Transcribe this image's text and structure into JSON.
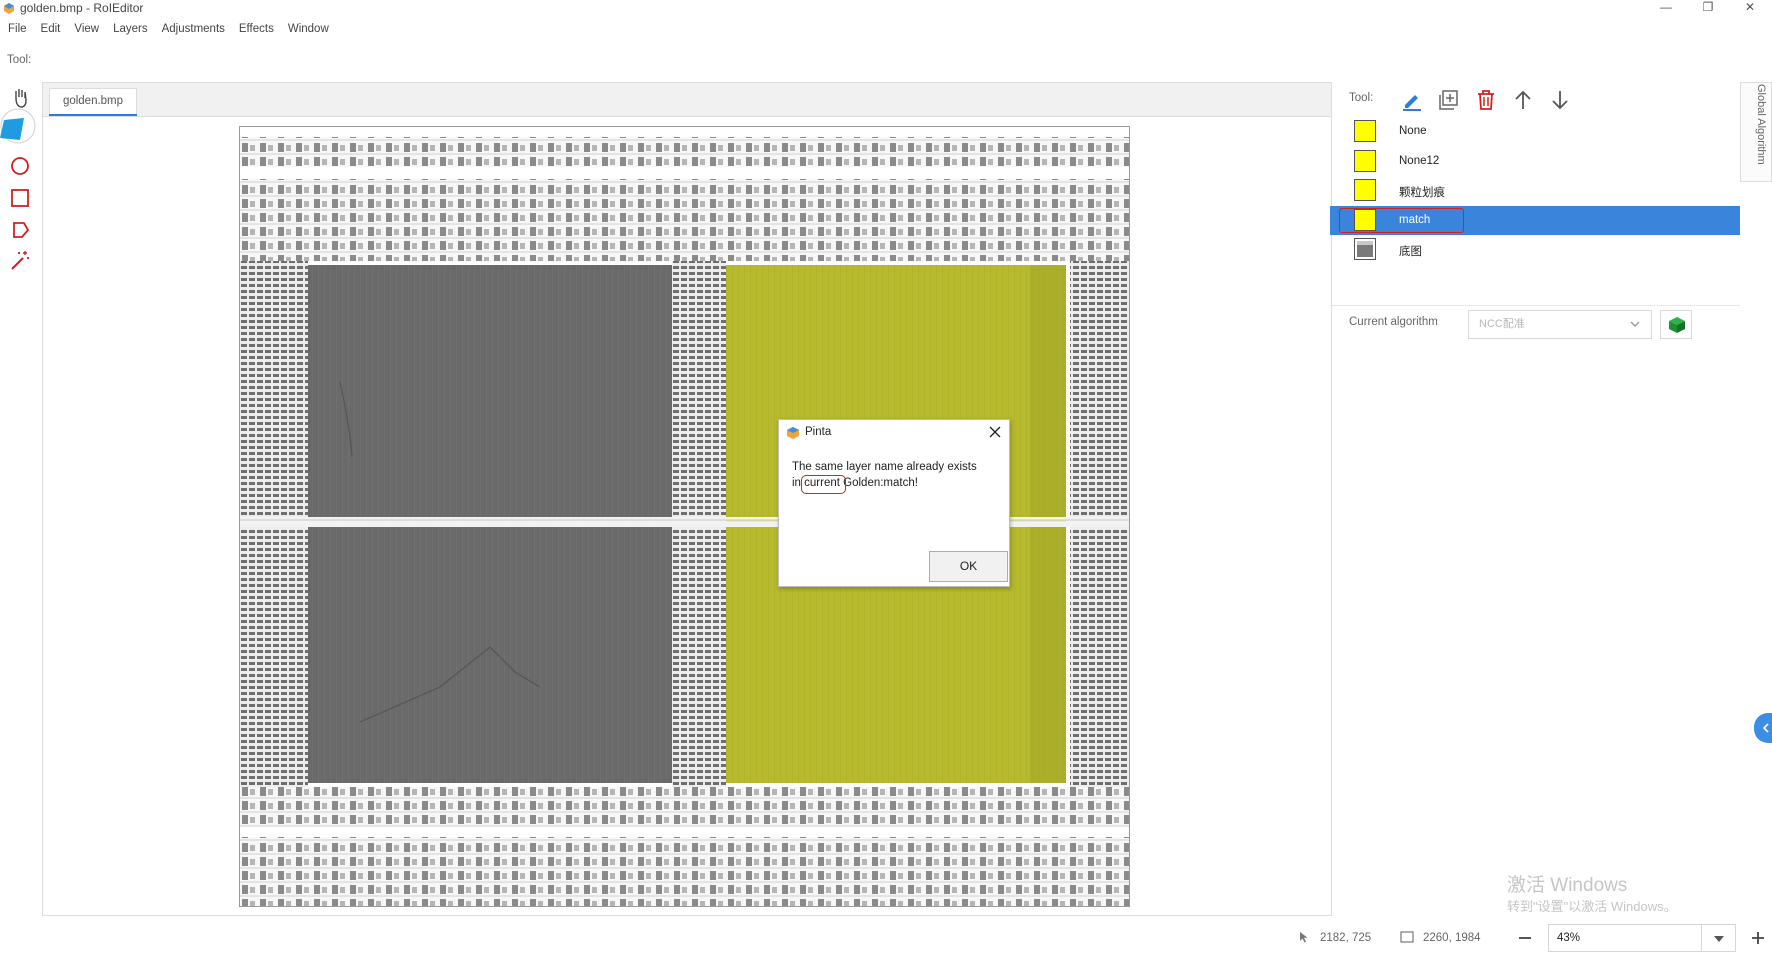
{
  "window": {
    "title": "golden.bmp - RoIEditor",
    "minimize": "—",
    "restore": "❐",
    "close": "✕"
  },
  "menu": [
    "File",
    "Edit",
    "View",
    "Layers",
    "Adjustments",
    "Effects",
    "Window"
  ],
  "toolbar": {
    "tool_label": "Tool:"
  },
  "document": {
    "tab": "golden.bmp"
  },
  "layers_panel": {
    "tool_label": "Tool:",
    "layers": [
      {
        "name": "None",
        "swatch": "#ffff00",
        "selected": false
      },
      {
        "name": "None12",
        "swatch": "#ffff00",
        "selected": false
      },
      {
        "name": "颗粒划痕",
        "swatch": "#ffff00",
        "selected": false
      },
      {
        "name": "match",
        "swatch": "#ffff00",
        "selected": true
      },
      {
        "name": "底图",
        "swatch": "image",
        "selected": false
      }
    ],
    "current_algorithm_label": "Current algorithm",
    "current_algorithm_value": "NCC配准"
  },
  "side_tab": {
    "label": "Global Algorithm"
  },
  "dialog": {
    "title": "Pinta",
    "message_line1": "The same layer name already exists",
    "message_line2_pre": "in ",
    "message_line2_highlight": "current",
    "message_line2_post": " Golden:match!",
    "ok_label": "OK"
  },
  "status": {
    "cursor_position": "2182, 725",
    "image_size": "2260, 1984",
    "zoom": "43%"
  },
  "watermark": {
    "line1": "激活 Windows",
    "line2": "转到\"设置\"以激活 Windows。"
  },
  "colors": {
    "selection": "#3a84dc",
    "accent_red": "#d42020",
    "layer_yellow": "#ffff00",
    "overlay_yellow": "#b3b82a",
    "die_gray": "#6b6b6b"
  }
}
